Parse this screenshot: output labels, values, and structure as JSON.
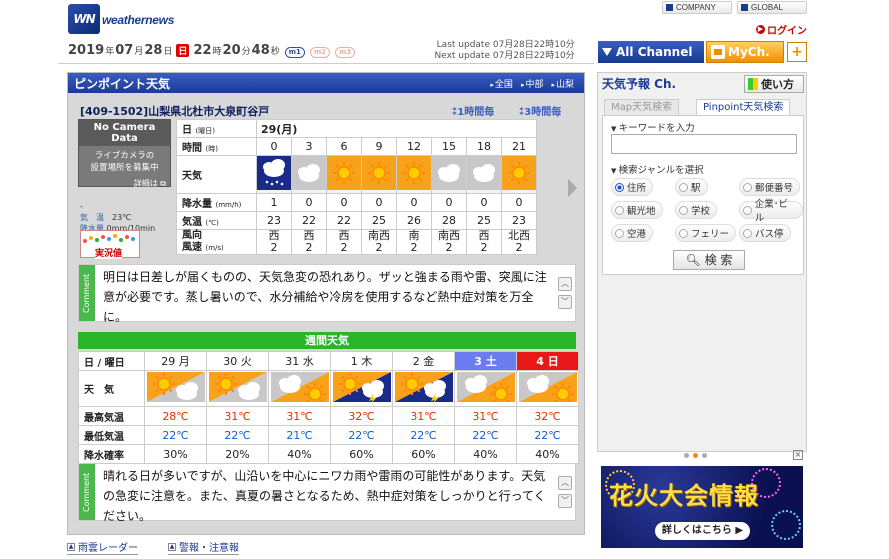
{
  "header": {
    "logo_mark": "WN",
    "logo_text": "weathernews",
    "company": "COMPANY",
    "global": "GLOBAL",
    "login": "ログイン"
  },
  "timebar": {
    "year": "2019",
    "y_u": "年",
    "month": "07",
    "m_u": "月",
    "day": "28",
    "d_u": "日",
    "dow": "日",
    "hour": "22",
    "h_u": "時",
    "min": "20",
    "mi_u": "分",
    "sec": "48",
    "s_u": "秒",
    "pill1": "m1",
    "pill2": "m2",
    "pill3": "m3",
    "last_label": "Last update",
    "last_value": "07月28日22時10分",
    "next_label": "Next update",
    "next_value": "07月28日22時10分"
  },
  "channel": {
    "all": "All Channel",
    "my": "MyCh.",
    "plus": "+"
  },
  "pinpoint": {
    "title": "ピンポイント天気",
    "crumbs": [
      "全国",
      "中部",
      "山梨"
    ],
    "location": "[409-1502]山梨県北杜市大泉町谷戸",
    "hour1": "1時間毎",
    "hour3": "3時間毎",
    "camera": {
      "title": "No Camera Data",
      "line1": "ライブカメラの",
      "line2": "設置場所を募集中",
      "detail": "詳細は"
    },
    "obs": {
      "dash": "-",
      "temp_label": "気　温",
      "temp": "23℃",
      "rain_label": "降水量",
      "rain": "0mm/10min"
    },
    "jikkyo": "実況値",
    "rows": {
      "date": {
        "label": "日",
        "unit": "(曜日)",
        "value": "29(月)"
      },
      "time": {
        "label": "時間",
        "unit": "(時)",
        "values": [
          "0",
          "3",
          "6",
          "9",
          "12",
          "15",
          "18",
          "21"
        ]
      },
      "weather": {
        "label": "天気",
        "icons": [
          "rain-night",
          "cloudy",
          "sunny",
          "sunny",
          "sunny",
          "cloudy",
          "cloudy",
          "sunny"
        ]
      },
      "precip": {
        "label": "降水量",
        "unit": "(mm/h)",
        "values": [
          "1",
          "0",
          "0",
          "0",
          "0",
          "0",
          "0",
          "0"
        ]
      },
      "temp": {
        "label": "気温",
        "unit": "(℃)",
        "values": [
          "23",
          "22",
          "22",
          "25",
          "26",
          "28",
          "25",
          "23"
        ]
      },
      "wind_dir": {
        "label": "風向",
        "values": [
          "西",
          "西",
          "西",
          "南西",
          "南",
          "南西",
          "西",
          "北西"
        ]
      },
      "wind_speed": {
        "label": "風速",
        "unit": "(m/s)",
        "values": [
          "2",
          "2",
          "2",
          "2",
          "2",
          "2",
          "2",
          "2"
        ]
      }
    },
    "comment_tag": "Comment",
    "comment": "明日は日差しが届くものの、天気急変の恐れあり。ザッと強まる雨や雷、突風に注意が必要です。蒸し暑いので、水分補給や冷房を使用するなど熱中症対策を万全に。"
  },
  "weekly": {
    "title": "週間天気",
    "labels": {
      "day": "日 / 曜日",
      "weather": "天　気",
      "high": "最高気温",
      "low": "最低気温",
      "rain": "降水確率"
    },
    "days": [
      {
        "d": "29",
        "w": "月",
        "icon": "sunny-cloudy",
        "hi": "28℃",
        "lo": "22℃",
        "rain": "30%"
      },
      {
        "d": "30",
        "w": "火",
        "icon": "sunny-cloudy",
        "hi": "31℃",
        "lo": "22℃",
        "rain": "20%"
      },
      {
        "d": "31",
        "w": "水",
        "icon": "cloudy-sunny",
        "hi": "31℃",
        "lo": "21℃",
        "rain": "40%"
      },
      {
        "d": "1",
        "w": "木",
        "icon": "sunny-thunder",
        "hi": "32℃",
        "lo": "22℃",
        "rain": "60%"
      },
      {
        "d": "2",
        "w": "金",
        "icon": "sunny-thunder",
        "hi": "31℃",
        "lo": "22℃",
        "rain": "60%"
      },
      {
        "d": "3",
        "w": "土",
        "icon": "cloudy-sunny",
        "hi": "31℃",
        "lo": "22℃",
        "rain": "40%"
      },
      {
        "d": "4",
        "w": "日",
        "icon": "cloudy-sunny",
        "hi": "32℃",
        "lo": "22℃",
        "rain": "40%"
      }
    ],
    "comment_tag": "Comment",
    "comment": "晴れる日が多いですが、山沿いを中心にニワカ雨や雷雨の可能性があります。天気の急変に注意を。また、真夏の暑さとなるため、熱中症対策をしっかりと行ってください。"
  },
  "bottom": {
    "radar": "雨雲レーダー",
    "alert": "警報・注意報"
  },
  "right": {
    "title": "天気予報 Ch.",
    "howto": "使い方",
    "tab1": "Map天気検索",
    "tab2": "Pinpoint天気検索",
    "kw_label": "キーワードを入力",
    "genre_label": "検索ジャンルを選択",
    "genres": [
      "住所",
      "駅",
      "郵便番号",
      "観光地",
      "学校",
      "企業･ビル",
      "空港",
      "フェリー",
      "バス停"
    ],
    "search": "検 索",
    "banner_title": "花火大会情報",
    "banner_btn": "詳しくはこちら"
  },
  "colors": {
    "brand_blue": "#1a3a98",
    "accent_orange": "#f09000",
    "green": "#2ab52a",
    "high": "#e03000",
    "low": "#1060d0"
  }
}
